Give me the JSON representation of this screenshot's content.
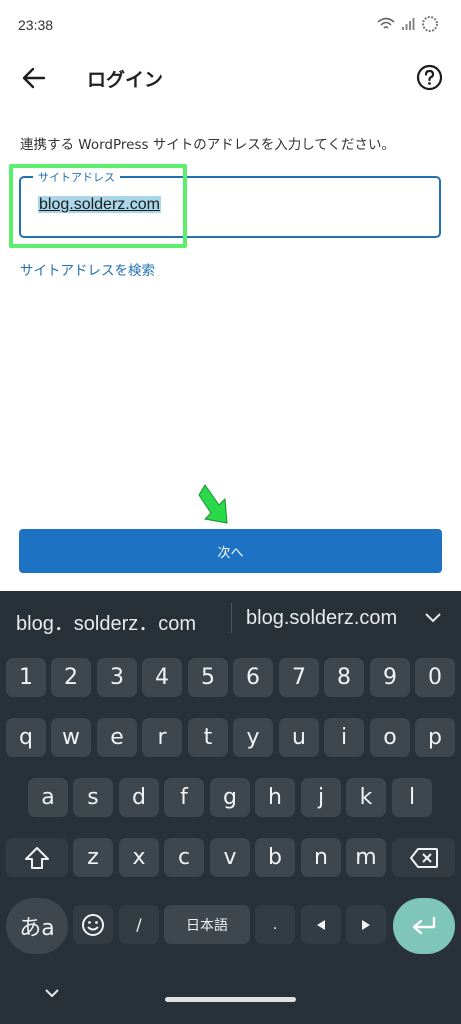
{
  "status_bar": {
    "time": "23:38"
  },
  "app_bar": {
    "title": "ログイン"
  },
  "form": {
    "instruction": "連携する WordPress サイトのアドレスを入力してください。",
    "field_label": "サイトアドレス",
    "field_value": "blog.solderz.com",
    "search_link": "サイトアドレスを検索",
    "next_button": "次へ"
  },
  "keyboard": {
    "suggestions": [
      "blog．solderz．com",
      "blog.solderz.com"
    ],
    "row_numbers": [
      "1",
      "2",
      "3",
      "4",
      "5",
      "6",
      "7",
      "8",
      "9",
      "0"
    ],
    "row_top": [
      "q",
      "w",
      "e",
      "r",
      "t",
      "y",
      "u",
      "i",
      "o",
      "p"
    ],
    "row_home": [
      "a",
      "s",
      "d",
      "f",
      "g",
      "h",
      "j",
      "k",
      "l"
    ],
    "row_bottom": [
      "z",
      "x",
      "c",
      "v",
      "b",
      "n",
      "m"
    ],
    "mode_key": "あa",
    "slash_key": "/",
    "space_key": "日本語",
    "period_key": "."
  },
  "colors": {
    "accent": "#1e72c4",
    "annotation": "#5bef6c",
    "keyboard_bg": "#283137",
    "enter_key": "#7fc5b9"
  },
  "icons": {
    "back": "arrow-left-icon",
    "help": "question-circle-icon",
    "backspace": "backspace-icon",
    "shift": "shift-icon",
    "emoji": "emoji-icon",
    "enter": "enter-icon",
    "annotation_arrow": "arrow-down-icon"
  }
}
